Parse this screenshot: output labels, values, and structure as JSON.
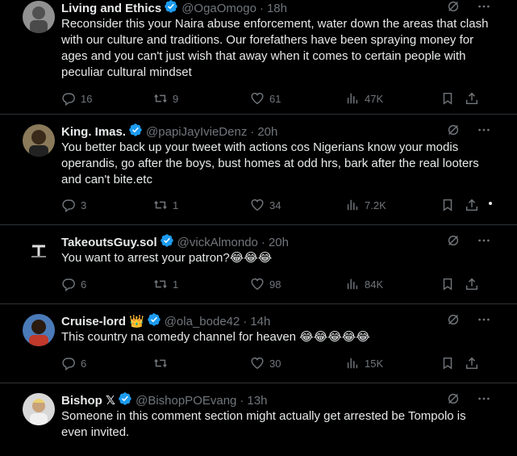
{
  "tweets": [
    {
      "name": "Living and Ethics",
      "handle": "@OgaOmogo",
      "time": "18h",
      "text": "Reconsider this your Naira abuse enforcement, water down the areas that clash with our culture and traditions. Our forefathers have been spraying money for ages and you can't just wish that away when it comes to certain people with peculiar cultural mindset",
      "replies": "16",
      "reposts": "9",
      "likes": "61",
      "views": "47K"
    },
    {
      "name": "King. Imas.",
      "handle": "@papiJayIvieDenz",
      "time": "20h",
      "text": "You better back up your tweet with actions cos Nigerians know your modis operandis, go after the boys, bust homes at odd hrs, bark after the real looters and can't bite.etc",
      "replies": "3",
      "reposts": "1",
      "likes": "34",
      "views": "7.2K"
    },
    {
      "name": "TakeoutsGuy.sol",
      "handle": "@vickAlmondo",
      "time": "20h",
      "text": "You want to arrest your patron?😂😂😂",
      "replies": "6",
      "reposts": "1",
      "likes": "98",
      "views": "84K"
    },
    {
      "name": "Cruise-lord",
      "name_emoji": "👑",
      "handle": "@ola_bode42",
      "time": "14h",
      "text": "This country na comedy channel for heaven 😂😂😂😂😂",
      "replies": "6",
      "reposts": "",
      "likes": "30",
      "views": "15K"
    },
    {
      "name": "Bishop 𝕏",
      "handle": "@BishopPOEvang",
      "time": "13h",
      "text": "Someone in this comment section might actually get arrested be Tompolo is even invited."
    }
  ],
  "separator": "·",
  "colors": {
    "background": "#000000",
    "text": "#e7e9ea",
    "muted": "#71767b",
    "verified": "#1d9bf0",
    "divider": "#2f3336"
  },
  "icons": [
    "verified-badge-icon",
    "grok-icon",
    "more-icon",
    "reply-icon",
    "repost-icon",
    "like-icon",
    "views-icon",
    "bookmark-icon",
    "share-icon"
  ]
}
